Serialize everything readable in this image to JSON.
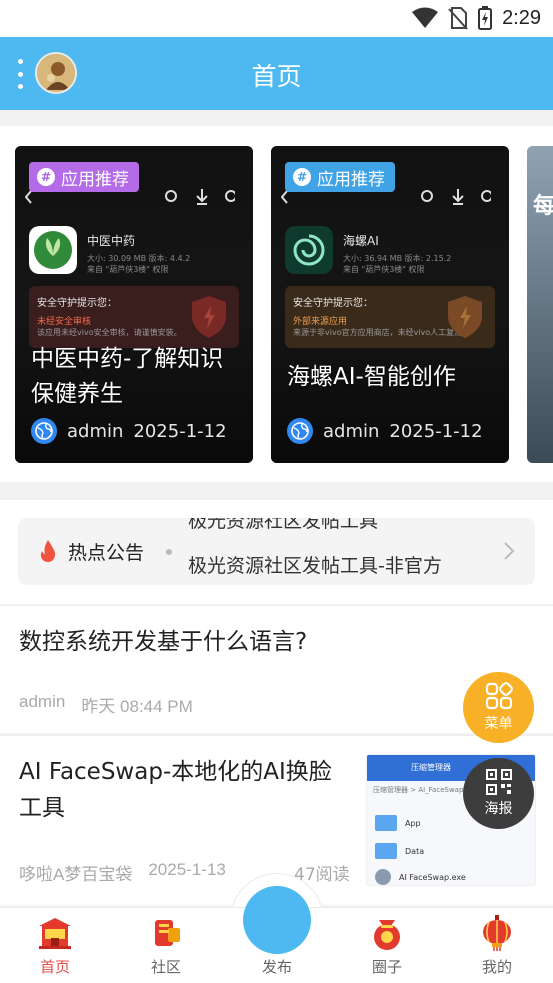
{
  "status_bar": {
    "time": "2:29"
  },
  "header": {
    "title": "首页"
  },
  "cards": [
    {
      "tag": "应用推荐",
      "title": "中医中药-了解知识保健养生",
      "author": "admin",
      "date": "2025-1-12",
      "app_name": "中医中药",
      "app_info": "大小: 30.09 MB  版本: 4.4.2",
      "app_source": "来自 \"葫芦侠3楼\"  权限",
      "warn_title": "安全守护提示您：",
      "warn_red": "未经安全审核",
      "warn_grey": "该应用未经vivo安全审核，请谨慎安装。",
      "tag_color": "#b46be8"
    },
    {
      "tag": "应用推荐",
      "title": "海螺AI-智能创作",
      "author": "admin",
      "date": "2025-1-12",
      "app_name": "海螺AI",
      "app_info": "大小: 36.94 MB  版本: 2.15.2",
      "app_source": "来自 \"葫芦侠3楼\"  权限",
      "warn_title": "安全守护提示您：",
      "warn_red": "外部来源应用",
      "warn_grey": "来源于非vivo官方应用商店，未经vivo人工复测。",
      "tag_color": "#3fa3e6"
    },
    {
      "partial_text": "每"
    }
  ],
  "notice": {
    "label": "热点公告",
    "prev_text": "极光资源社区发帖工具",
    "text": "极光资源社区发帖工具-非官方"
  },
  "posts": [
    {
      "title": "数控系统开发基于什么语言?",
      "author": "admin",
      "time_word": "昨天",
      "time": "08:44 PM"
    },
    {
      "title": "AI FaceSwap-本地化的AI换脸工具",
      "author": "哆啦A梦百宝袋",
      "date": "2025-1-13",
      "reads": "47阅读",
      "thumb_header": "压缩管理器",
      "thumb_path": "压缩管理器 > AI_FaceSwap_2 >",
      "thumb_items": [
        "App",
        "Data",
        "AI FaceSwap.exe"
      ]
    }
  ],
  "fabs": {
    "menu": "菜单",
    "poster": "海报"
  },
  "nav": {
    "home": "首页",
    "community": "社区",
    "publish": "发布",
    "circle": "圈子",
    "mine": "我的"
  },
  "colors": {
    "header": "#4eb9f0",
    "accent_red": "#e84b4b",
    "fab_menu": "#f8b027",
    "fab_poster": "#3d3d3d"
  }
}
